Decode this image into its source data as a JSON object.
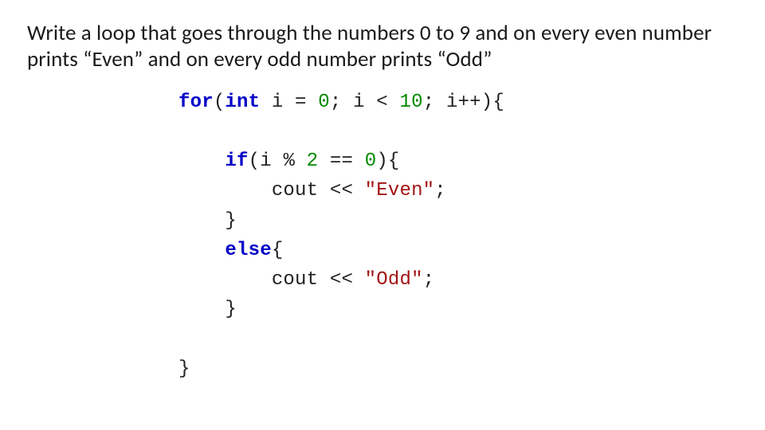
{
  "slide": {
    "prompt": "Write a loop that goes through the numbers 0 to 9 and on every even number prints “Even” and on every odd number prints “Odd”",
    "code": {
      "kw_for": "for",
      "kw_int": "int",
      "kw_if": "if",
      "kw_else": "else",
      "var_i": "i",
      "zero": "0",
      "ten": "10",
      "two": "2",
      "eqzero": "0",
      "cout": "cout",
      "str_even": "\"Even\"",
      "str_odd": "\"Odd\"",
      "op_assign": " = ",
      "op_lt": " < ",
      "op_inc": "++",
      "op_mod": " % ",
      "op_eqeq": " == ",
      "op_ins": " << ",
      "lp": "(",
      "rp": ")",
      "lb": "{",
      "rb": "}",
      "semi": ";",
      "sp": " "
    }
  }
}
